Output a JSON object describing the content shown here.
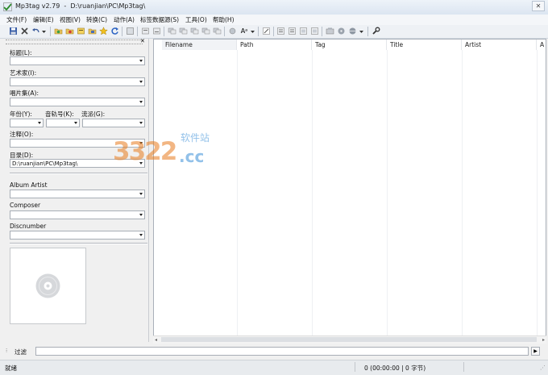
{
  "window": {
    "title": "Mp3tag v2.79  -  D:\\ruanjian\\PC\\Mp3tag\\",
    "close_glyph": "✕"
  },
  "menu": [
    "文件(F)",
    "编辑(E)",
    "视图(V)",
    "转换(C)",
    "动作(A)",
    "标签数据源(S)",
    "工具(O)",
    "帮助(H)"
  ],
  "toolbar": {
    "icons": [
      "save-icon",
      "remove-tag-icon",
      "undo-icon",
      "dropdown-icon",
      "open-folder-icon",
      "add-folder-icon",
      "save-playlist-icon",
      "export-icon",
      "favorite-star-icon",
      "refresh-icon",
      "select-all-icon",
      "tag-to-filename-icon",
      "filename-to-tag-icon",
      "tag-to-tag-icon",
      "text-file-to-tag-icon",
      "autonumber-icon",
      "case-conversion-icon",
      "actions-icon",
      "extended-tags-icon",
      "playlist-icon",
      "export-report-icon",
      "freedb-icon",
      "discogs-icon",
      "musicbrainz-icon",
      "amazon-icon",
      "web-sources-icon",
      "options-icon"
    ],
    "case_glyph": "Aᵃ"
  },
  "panel": {
    "title_label": "标题(L):",
    "artist_label": "艺术家(I):",
    "album_label": "唱片集(A):",
    "year_label": "年份(Y):",
    "track_label": "音轨号(K):",
    "genre_label": "流派(G):",
    "comment_label": "注释(O):",
    "directory_label": "目录(D):",
    "directory_value": "D:\\ruanjian\\PC\\Mp3tag\\",
    "album_artist_label": "Album Artist",
    "composer_label": "Composer",
    "discnumber_label": "Discnumber"
  },
  "filelist": {
    "columns": [
      "Filename",
      "Path",
      "Tag",
      "Title",
      "Artist",
      "A"
    ]
  },
  "filter": {
    "label": "过滤",
    "button_glyph": "▶"
  },
  "status": {
    "left": "就绪",
    "summary": "0 (00:00:00 | 0 字节)"
  },
  "watermark": {
    "number": "3322",
    "suffix": ".cc",
    "cn": "软件站"
  },
  "colors": {
    "accent": "#2f6fd1",
    "watermark_orange": "#e87c1e",
    "watermark_blue": "#3a8fd8"
  }
}
